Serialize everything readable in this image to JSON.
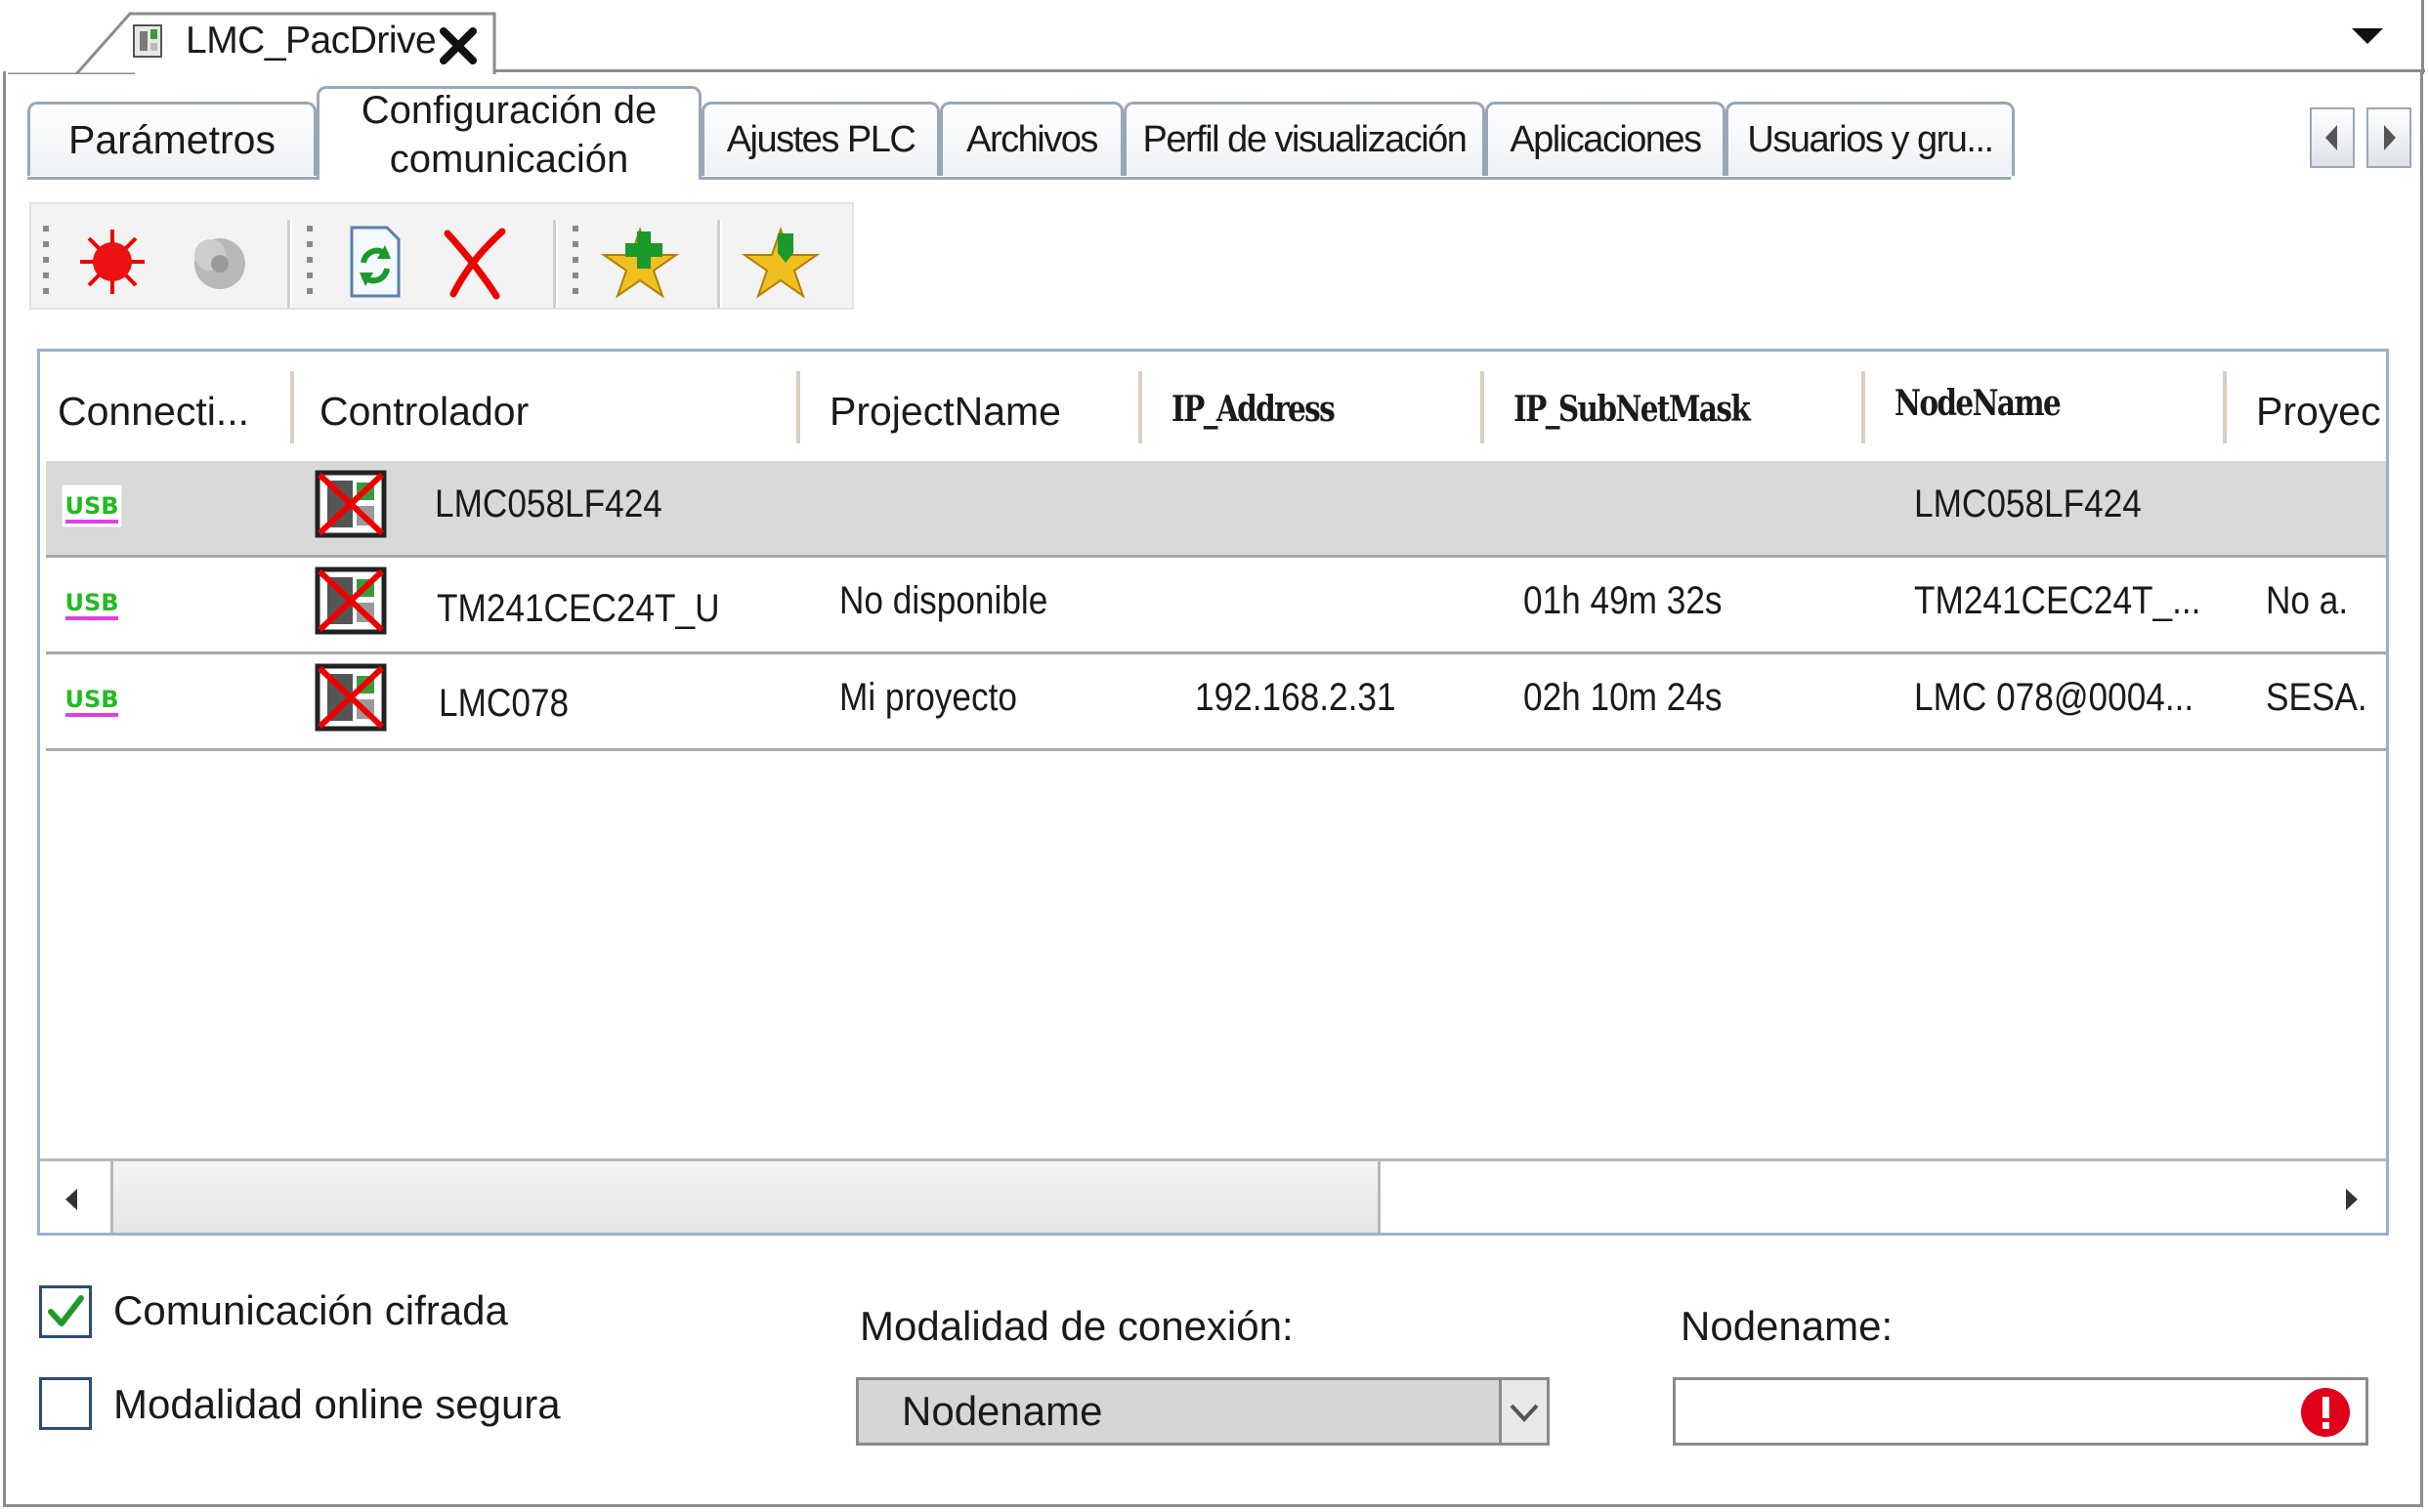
{
  "document_tab": {
    "title": "LMC_PacDrive"
  },
  "tabs": [
    {
      "label": "Parámetros"
    },
    {
      "label_line1": "Configuración de",
      "label_line2": "comunicación"
    },
    {
      "label": "Ajustes PLC"
    },
    {
      "label": "Archivos"
    },
    {
      "label": "Perfil de visualización"
    },
    {
      "label": "Aplicaciones"
    },
    {
      "label": "Usuarios y gru..."
    }
  ],
  "toolbar": {
    "icons": [
      "red-burst-icon",
      "gray-gear-icon",
      "refresh-document-icon",
      "red-x-delete-icon",
      "star-add-icon",
      "star-edit-icon"
    ]
  },
  "table": {
    "columns": [
      "Connecti...",
      "Controlador",
      "ProjectName",
      "IP_Address",
      "IP_SubNetMask",
      "NodeName",
      "Proyec"
    ],
    "rows": [
      {
        "connection": "USB",
        "controller": "LMC058LF424",
        "project": "",
        "ip": "",
        "subnet": "",
        "nodename": "LMC058LF424",
        "proyecto": ""
      },
      {
        "connection": "USB",
        "controller": "TM241CEC24T_U",
        "project": "No disponible",
        "ip": "",
        "subnet": "01h 49m 32s",
        "nodename": "TM241CEC24T_...",
        "proyecto": "No a."
      },
      {
        "connection": "USB",
        "controller": "LMC078",
        "project": "Mi proyecto",
        "ip": "192.168.2.31",
        "subnet": "02h 10m 24s",
        "nodename": "LMC 078@0004...",
        "proyecto": "SESA."
      }
    ]
  },
  "options": {
    "encrypted": {
      "label": "Comunicación cifrada",
      "checked": true
    },
    "secure_online": {
      "label": "Modalidad online segura",
      "checked": false
    }
  },
  "connection_mode": {
    "label": "Modalidad de conexión:",
    "value": "Nodename"
  },
  "nodename": {
    "label": "Nodename:",
    "value": ""
  },
  "colors": {
    "selected_row": "#d9d9d9",
    "tab_border": "#9aa7b5",
    "grid_border": "#9bb1c9",
    "usb_green": "#22bb22",
    "usb_magenta": "#e040e0",
    "error_red": "#e0001a"
  }
}
